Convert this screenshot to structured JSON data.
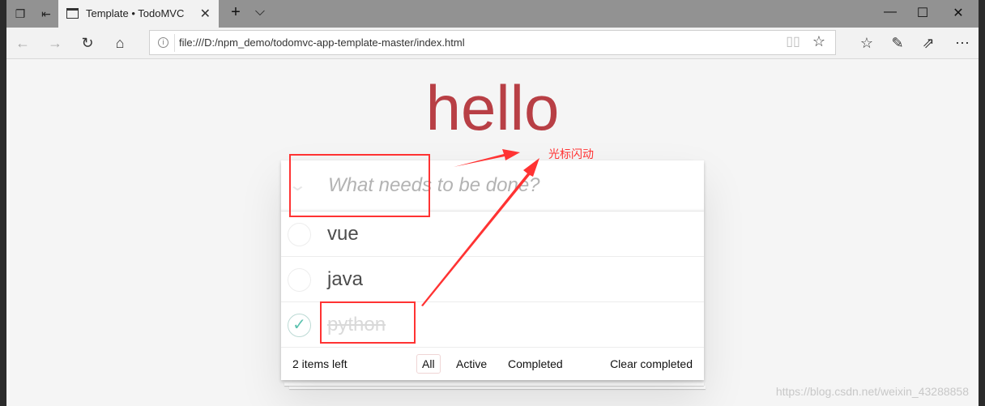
{
  "browser": {
    "tab_title": "Template • TodoMVC",
    "url": "file:///D:/npm_demo/todomvc-app-template-master/index.html"
  },
  "app": {
    "title": "hello",
    "new_todo_placeholder": "What needs to be done?",
    "todos": [
      {
        "label": "vue",
        "completed": false
      },
      {
        "label": "java",
        "completed": false
      },
      {
        "label": "python",
        "completed": true
      }
    ],
    "footer": {
      "count": "2 items left",
      "filters": [
        "All",
        "Active",
        "Completed"
      ],
      "selected_filter": "All",
      "clear": "Clear completed"
    },
    "accent": "#b83f45"
  },
  "annotation": {
    "text": "光标闪动",
    "color": "#ff3333"
  },
  "watermark": "https://blog.csdn.net/weixin_43288858"
}
